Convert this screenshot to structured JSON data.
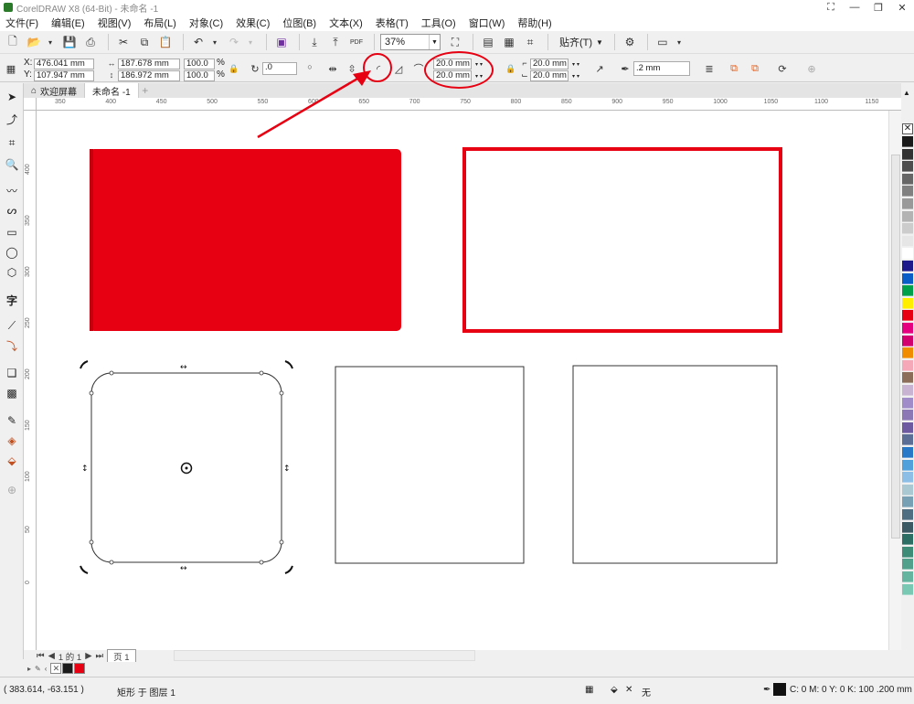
{
  "window": {
    "title": "CorelDRAW X8 (64-Bit) - 未命名 -1",
    "controls": [
      "⛶",
      "—",
      "❐",
      "✕"
    ]
  },
  "menu": [
    "文件(F)",
    "编辑(E)",
    "视图(V)",
    "布局(L)",
    "对象(C)",
    "效果(C)",
    "位图(B)",
    "文本(X)",
    "表格(T)",
    "工具(O)",
    "窗口(W)",
    "帮助(H)"
  ],
  "toolbar": {
    "zoom": "37%",
    "snap_label": "贴齐(T)",
    "pdf_label": "PDF"
  },
  "propbar": {
    "x_label": "X:",
    "x_value": "476.041 mm",
    "y_label": "Y:",
    "y_value": "107.947 mm",
    "width_value": "187.678 mm",
    "height_value": "186.972 mm",
    "scale_x": "100.0",
    "scale_y": "100.0",
    "percent": "%",
    "rotation": ".0",
    "corner_tl": "20.0 mm",
    "corner_bl": "20.0 mm",
    "corner_tr": "20.0 mm",
    "corner_br": "20.0 mm",
    "outline_width": ".2 mm"
  },
  "tabs": [
    {
      "label": "欢迎屏幕"
    },
    {
      "label": "未命名 -1"
    }
  ],
  "ruler": {
    "horizontal_ticks": [
      "350",
      "400",
      "450",
      "500",
      "550",
      "600",
      "650",
      "700",
      "750",
      "800",
      "850",
      "900",
      "950",
      "1000",
      "1050",
      "1100",
      "1150"
    ],
    "vertical_ticks": [
      "400",
      "350",
      "300",
      "250",
      "200",
      "150",
      "100",
      "50",
      "0"
    ],
    "unit": "毫米"
  },
  "page_nav": {
    "indicator": "1 的 1",
    "page_tab": "页 1"
  },
  "palette_colors": [
    "#1a1a1a",
    "#333333",
    "#4d4d4d",
    "#666666",
    "#808080",
    "#999999",
    "#b3b3b3",
    "#cccccc",
    "#e6e6e6",
    "#ffffff",
    "#1f1a8c",
    "#0a5cc7",
    "#00a04a",
    "#ffee00",
    "#e60012",
    "#e4007f",
    "#d2006e",
    "#f08c00",
    "#f4a8b8",
    "#8c6d5a",
    "#c8b4d2",
    "#a08cc8",
    "#8c78b4",
    "#6e5aa0",
    "#5a6e96",
    "#2878c8",
    "#50a0dc",
    "#8cbee6",
    "#aac8d2",
    "#78a0b4",
    "#506e82",
    "#3c5a64",
    "#2d6e64",
    "#3c8c78",
    "#50a08c",
    "#64b4a0",
    "#78c8b4"
  ],
  "status": {
    "coords": "( 383.614, -63.151 )",
    "object_info": "矩形 于 图层 1",
    "fill_none": "无",
    "color_info": "C: 0 M: 0 Y: 0 K: 100  .200 mm"
  },
  "colors": {
    "accent_red": "#e60012"
  }
}
